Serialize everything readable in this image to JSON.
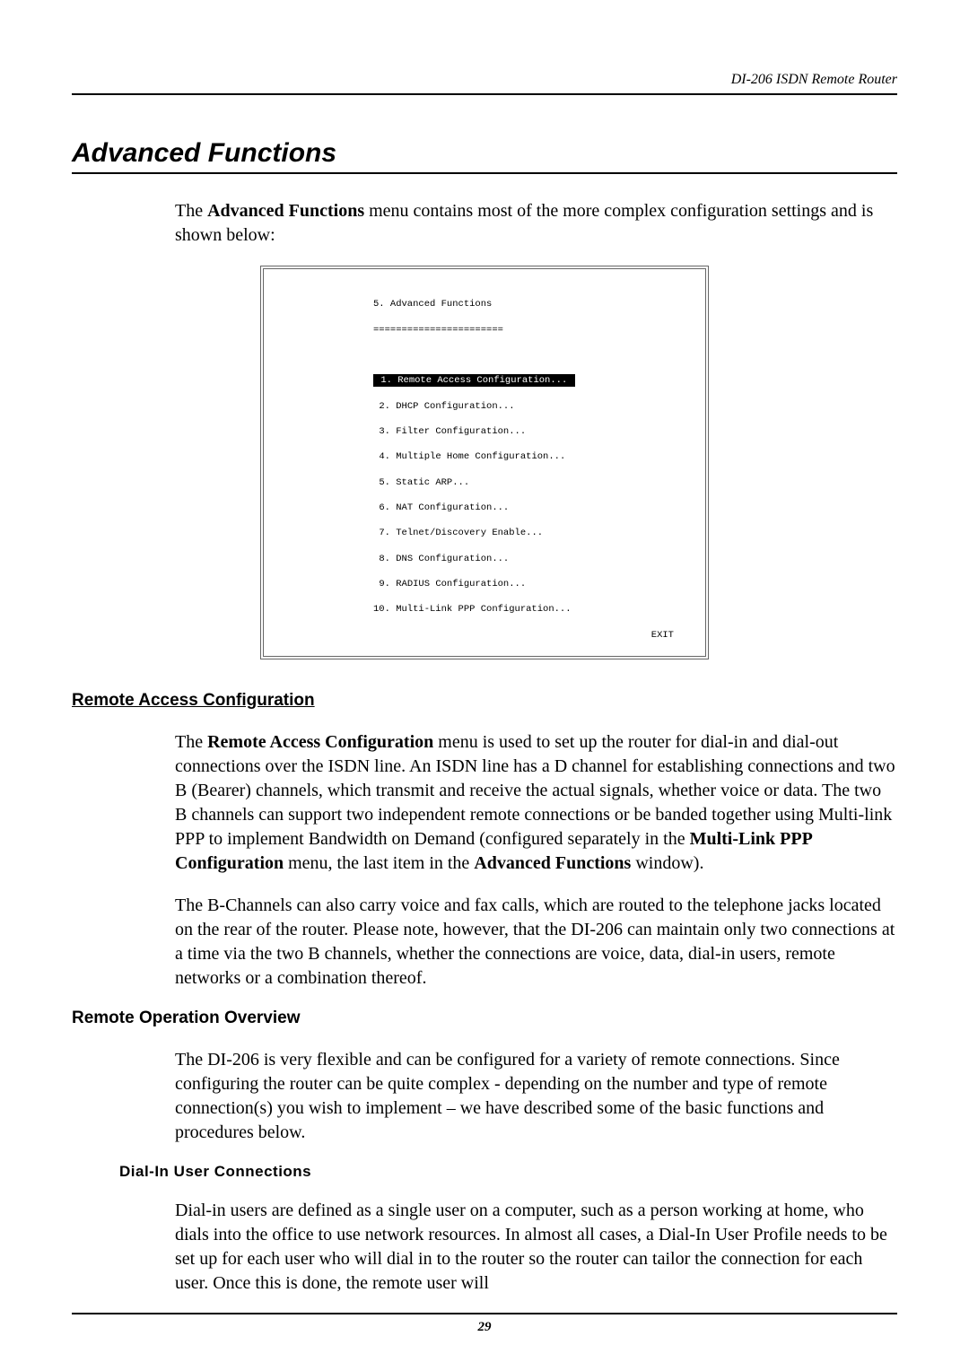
{
  "header": {
    "doc_title": "DI-206 ISDN Remote Router"
  },
  "title": "Advanced Functions",
  "intro": {
    "part1": "The ",
    "bold1": "Advanced Functions",
    "part2": " menu contains most of the more complex configuration settings and is shown below:"
  },
  "terminal": {
    "title_line": "5. Advanced Functions",
    "underline": "=======================",
    "items": [
      "1. Remote Access Configuration...",
      "2. DHCP Configuration...",
      "3. Filter Configuration...",
      "4. Multiple Home Configuration...",
      "5. Static ARP...",
      "6. NAT Configuration...",
      "7. Telnet/Discovery Enable...",
      "8. DNS Configuration...",
      "9. RADIUS Configuration..."
    ],
    "item10": "10. Multi-Link PPP Configuration...",
    "exit": "EXIT"
  },
  "section1": {
    "heading": "Remote Access Configuration",
    "para1": {
      "p1": "The ",
      "b1": "Remote Access Configuration",
      "p2": " menu is used to set up the router for dial-in and dial-out connections over the ISDN line. An ISDN line has a D channel for establishing connections and two B (Bearer) channels, which transmit and receive the actual signals, whether voice or data. The two B channels can support two independent remote connections or be banded together using Multi-link PPP to implement Bandwidth on Demand (configured separately in the ",
      "b2": "Multi-Link PPP Configuration",
      "p3": " menu, the last item in the ",
      "b3": "Advanced Functions",
      "p4": " window)."
    },
    "para2": "The B-Channels can also carry voice and fax calls, which are routed to the telephone jacks located on the rear of the router. Please note, however, that the DI-206 can maintain only two connections at a time via the two B channels, whether the connections are voice, data, dial-in users, remote networks or a combination thereof."
  },
  "section2": {
    "heading": "Remote Operation Overview",
    "para1": "The DI-206 is very flexible and can be configured for a variety of remote connections. Since configuring the router can be quite complex - depending on the number and type of remote connection(s) you wish to implement – we have described some of the basic functions and procedures below."
  },
  "section3": {
    "heading": "Dial-In User Connections",
    "para1": "Dial-in users are defined as a single user on a computer, such as a person working at home, who dials into the office to use network resources. In almost all cases, a Dial-In User Profile needs to be set up for each user who will dial in to the router so the router can tailor the connection for each user. Once this is done, the remote user will"
  },
  "footer": {
    "page": "29"
  }
}
